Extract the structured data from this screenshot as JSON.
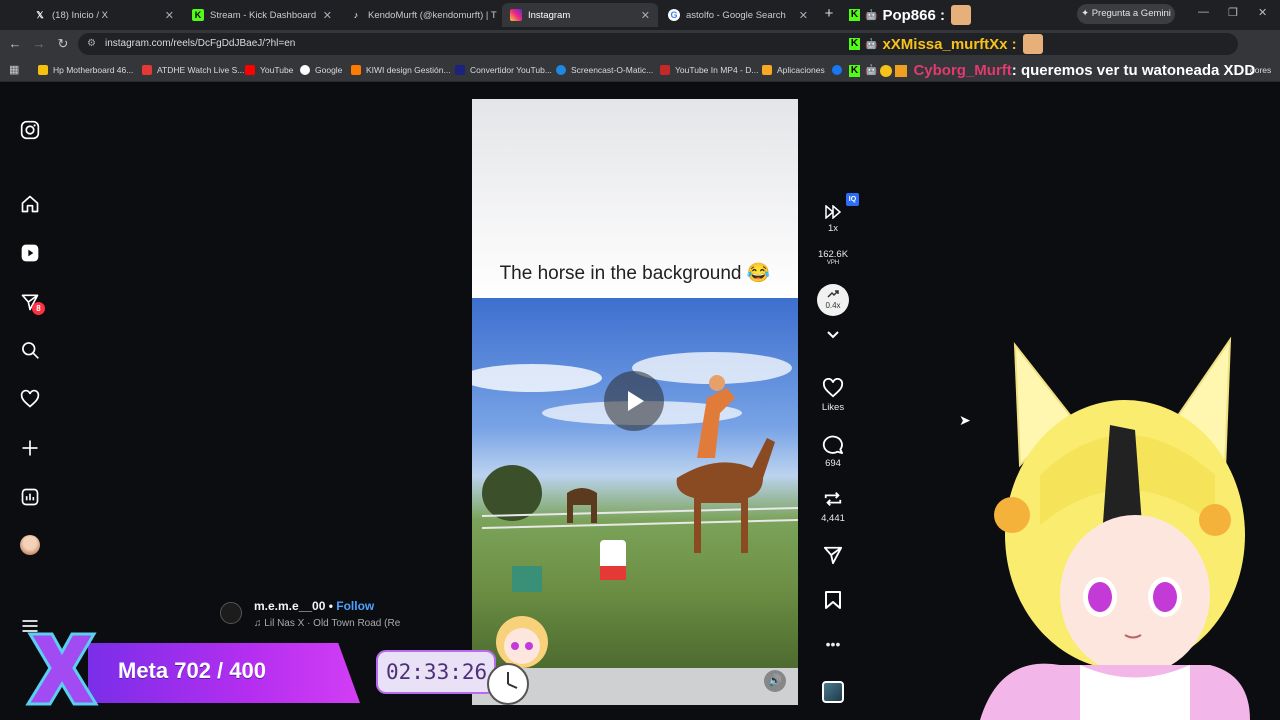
{
  "tabs": [
    {
      "label": "(18) Inicio / X",
      "icon": "x-icon"
    },
    {
      "label": "Stream - Kick Dashboard",
      "icon": "kick-icon"
    },
    {
      "label": "KendoMurft (@kendomurft) | T",
      "icon": "tiktok-icon"
    },
    {
      "label": "Instagram",
      "icon": "instagram-icon"
    },
    {
      "label": "astolfo - Google Search",
      "icon": "google-icon"
    }
  ],
  "browser": {
    "url": "instagram.com/reels/DcFgDdJBaeJ/?hl=en",
    "gemini_label": "Pregunta a Gemini"
  },
  "bookmarks": [
    {
      "label": "Hp Motherboard 46..."
    },
    {
      "label": "ATDHE Watch Live S..."
    },
    {
      "label": "YouTube"
    },
    {
      "label": "Google"
    },
    {
      "label": "KIWI design Gestión..."
    },
    {
      "label": "Convertidor YouTub..."
    },
    {
      "label": "Screencast-O-Matic..."
    },
    {
      "label": "YouTube In MP4 - D..."
    },
    {
      "label": "Aplicaciones"
    },
    {
      "label": "dores"
    }
  ],
  "nav": {
    "messages_badge": "8"
  },
  "reel": {
    "caption": "The horse in the background 😂",
    "author": "m.e.m.e__00",
    "follow": "Follow",
    "audio": "Lil Nas X · Old Town Road (Re"
  },
  "sidebar_actions": {
    "speed": "1x",
    "vph_value": "162.6K",
    "vph_label": "VPH",
    "trend_value": "0.4x",
    "likes_label": "Likes",
    "comments_count": "694",
    "reposts_count": "4,441",
    "badge": "IQ"
  },
  "chat": [
    {
      "user": "Pop866 :",
      "message": "",
      "color": "#ffffff"
    },
    {
      "user": "xXMissa_murftXx :",
      "message": "",
      "color": "#f7c21a"
    },
    {
      "user": "Cyborg_Murft",
      "message": ": queremos ver tu watoneada XDD",
      "color": "#e23a6f"
    }
  ],
  "overlays": {
    "goal_text": "Meta 702 / 400",
    "timer": "02:33:26"
  },
  "colors": {
    "instagram_bg": "#0b0d10",
    "goal_purple": "#a13af0",
    "kick_green": "#53fc18"
  }
}
